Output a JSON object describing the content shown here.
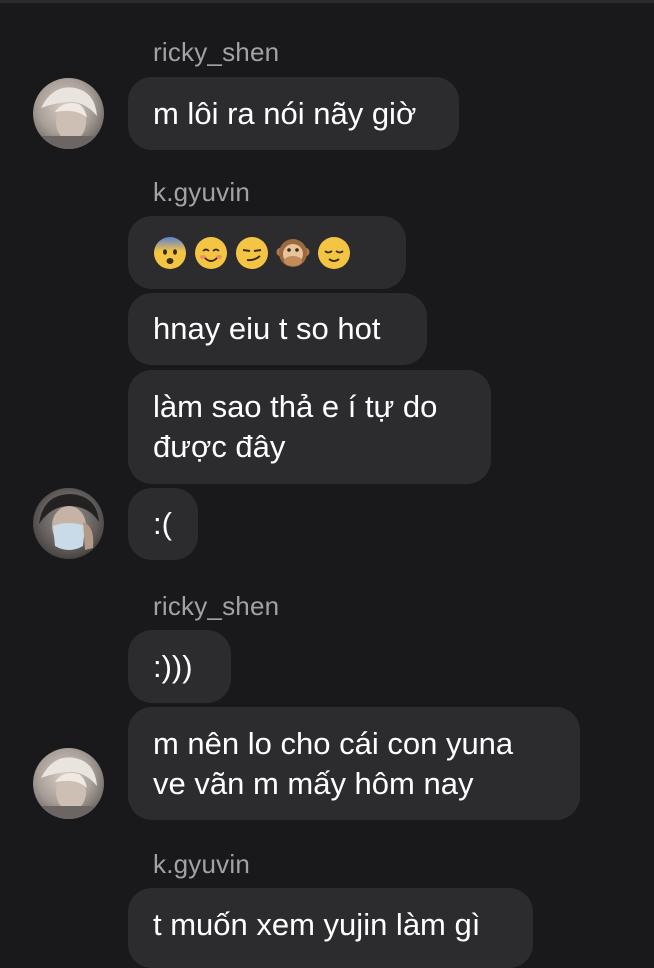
{
  "thread": {
    "messages": [
      {
        "sender": "ricky_shen",
        "texts": [
          "m lôi ra nói nãy giờ"
        ]
      },
      {
        "sender": "k.gyuvin",
        "emojis": [
          "fearful-face-emoji",
          "smiling-face-emoji",
          "smirking-face-emoji",
          "speak-no-evil-monkey-emoji",
          "relieved-face-emoji"
        ],
        "texts": [
          "hnay eiu t so hot",
          "làm sao thả e í tự do\nđược đây",
          ":("
        ]
      },
      {
        "sender": "ricky_shen",
        "texts": [
          ":)))",
          "m nên lo cho cái con yuna\nve vãn m mấy hôm nay"
        ]
      },
      {
        "sender": "k.gyuvin",
        "texts": [
          "t muốn xem yujin làm gì"
        ]
      }
    ]
  },
  "colors": {
    "background": "#19191b",
    "bubble": "#2c2c2f",
    "message_text": "#ffffff",
    "sender_text": "#a2a2a6"
  }
}
